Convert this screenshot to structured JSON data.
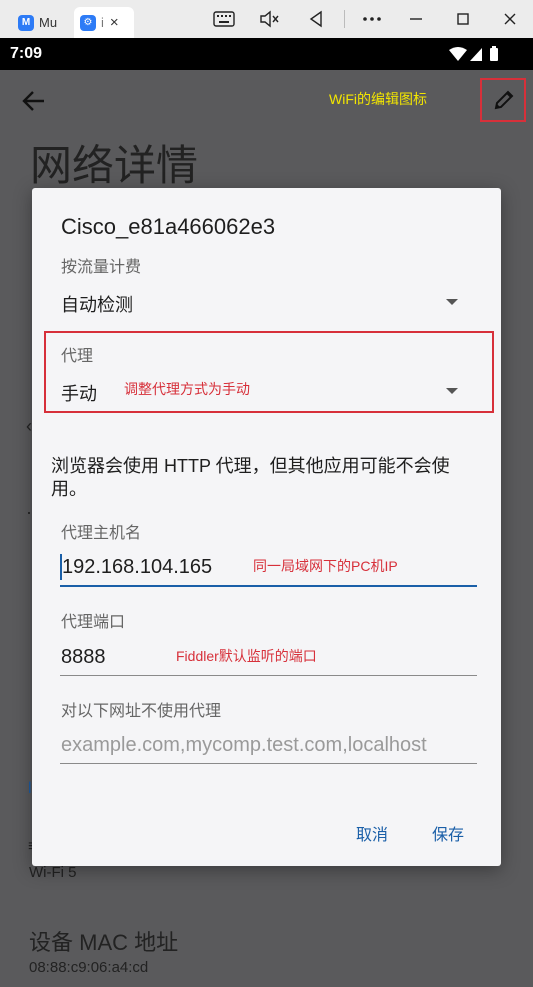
{
  "host_toolbar": {
    "tabs": [
      {
        "label": "Mu",
        "icon": "mumu-icon",
        "color": "#2d7bf6"
      },
      {
        "label": "i",
        "icon": "settings-icon",
        "color": "#2d7bf6"
      }
    ],
    "tab_close": "×",
    "buttons": [
      "keyboard-icon",
      "mute-icon",
      "back-icon",
      "more-icon",
      "minimize-icon",
      "maximize-icon",
      "close-icon"
    ]
  },
  "status_bar": {
    "time": "7:09"
  },
  "page": {
    "title": "网络详情",
    "annotation_edit": "WiFi的编辑图标",
    "wifi_standard": "Wi-Fi 5",
    "mac_label": "设备 MAC 地址",
    "mac_value": "08:88:c9:06:a4:cd"
  },
  "dialog": {
    "ssid": "Cisco_e81a466062e3",
    "metered_label": "按流量计费",
    "metered_value": "自动检测",
    "proxy_label": "代理",
    "proxy_value": "手动",
    "proxy_note": "调整代理方式为手动",
    "warning": "浏览器会使用 HTTP 代理，但其他应用可能不会使用。",
    "host_label": "代理主机名",
    "host_value": "192.168.104.165",
    "host_note": "同一局域网下的PC机IP",
    "port_label": "代理端口",
    "port_value": "8888",
    "port_note": "Fiddler默认监听的端口",
    "bypass_label": "对以下网址不使用代理",
    "bypass_placeholder": "example.com,mycomp.test.com,localhost",
    "cancel_label": "取消",
    "save_label": "保存"
  },
  "colors": {
    "accent": "#1a5fa8",
    "annotation_red": "#d7303a",
    "annotation_yellow": "#f3e600"
  }
}
